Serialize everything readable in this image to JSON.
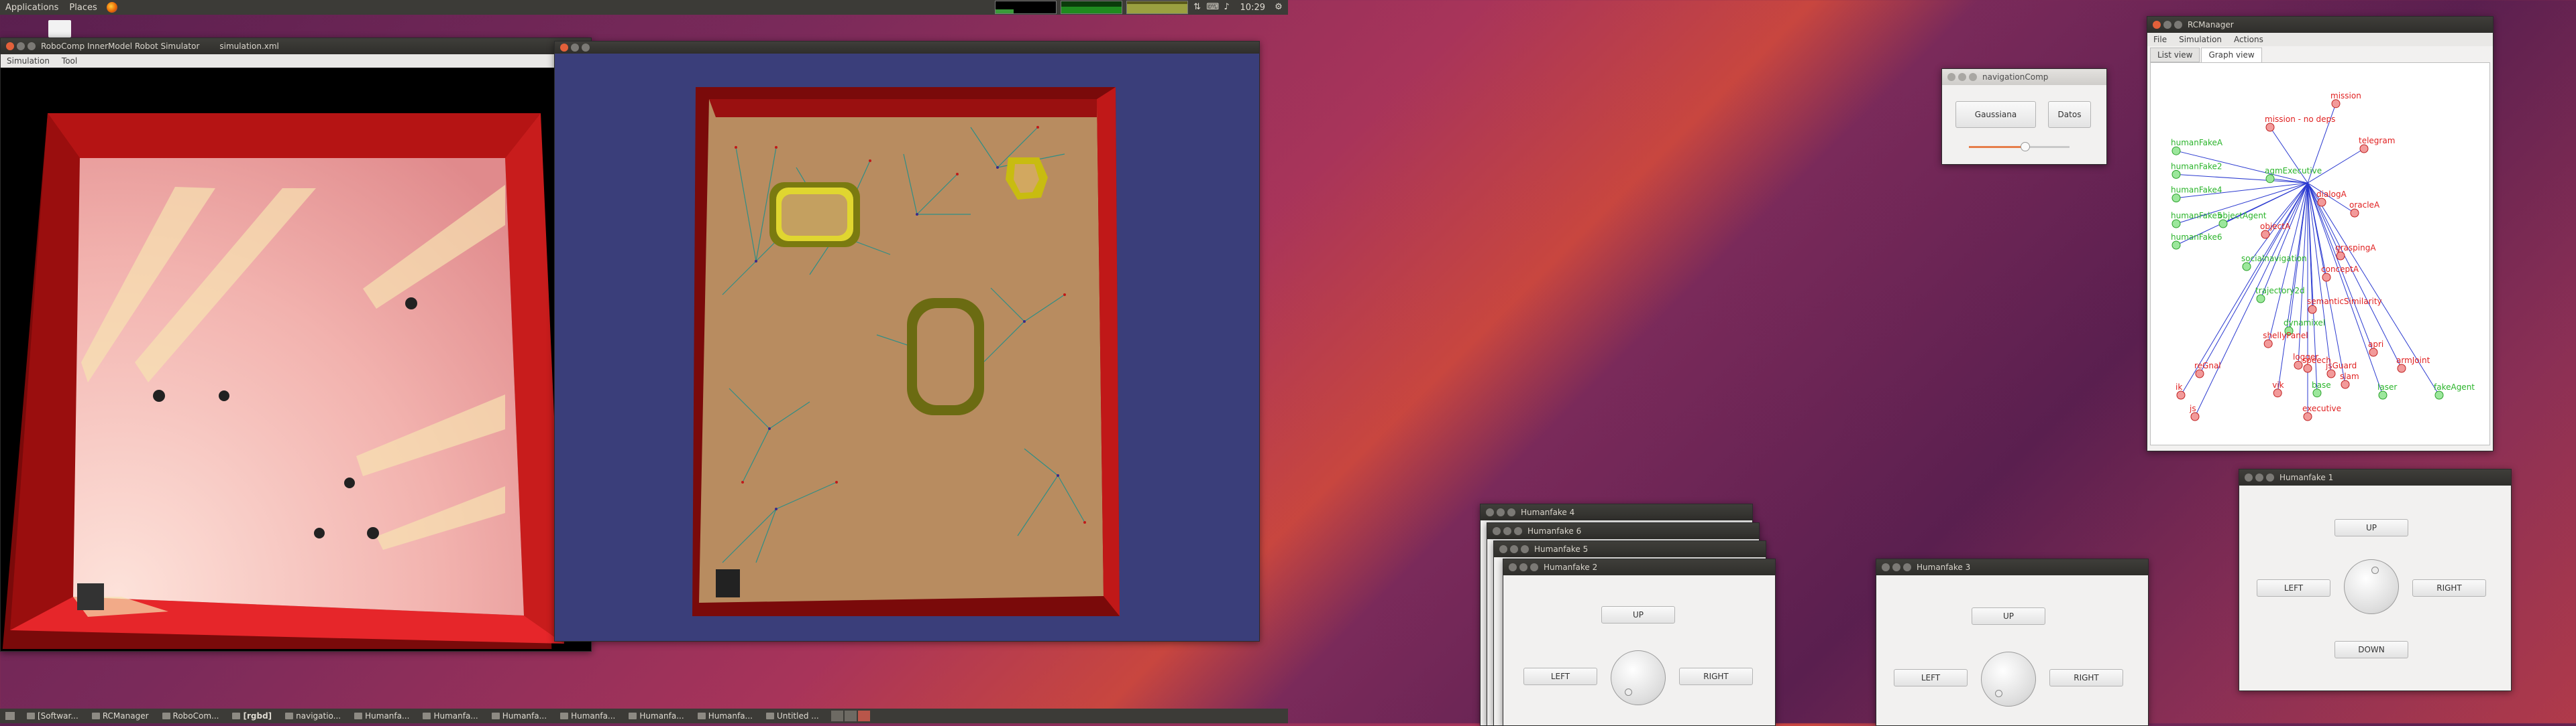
{
  "top_panel": {
    "applications": "Applications",
    "places": "Places",
    "clock": "10:29"
  },
  "simulator": {
    "title": "RoboComp InnerModel Robot Simulator",
    "file": "simulation.xml",
    "menu": [
      "Simulation",
      "Tool"
    ]
  },
  "navigation": {
    "title": "navigationComp",
    "buttons": [
      "Gaussiana",
      "Datos"
    ],
    "slider_value": 0.55
  },
  "rcmanager": {
    "title": "RCManager",
    "menu": [
      "File",
      "Simulation",
      "Actions"
    ],
    "tabs": [
      "List view",
      "Graph view"
    ],
    "active_tab": "Graph view",
    "green_nodes": [
      "humanFakeA",
      "humanFake2",
      "humanFake4",
      "humanFake5",
      "humanFake6",
      "agmExecutive",
      "objectAgent",
      "socialnavigation",
      "trajectory2d",
      "laser",
      "base",
      "fakeAgent",
      "dynamixel"
    ],
    "red_nodes": [
      "mission - no deps",
      "mission",
      "telegram",
      "dialogA",
      "oracleA",
      "graspingA",
      "semanticSimilarity",
      "shellyPanel",
      "logger",
      "vik",
      "speech",
      "jsGuard",
      "slam",
      "apri",
      "armJoint",
      "js",
      "ik",
      "executive",
      "conceptA",
      "objectA",
      "reGnal"
    ]
  },
  "humanfake_windows": [
    {
      "title": "Humanfake 4"
    },
    {
      "title": "Humanfake 6"
    },
    {
      "title": "Humanfake 5"
    },
    {
      "title": "Humanfake 2",
      "up": "UP",
      "left": "LEFT",
      "right": "RIGHT"
    },
    {
      "title": "Humanfake 3",
      "up": "UP",
      "left": "LEFT",
      "right": "RIGHT"
    },
    {
      "title": "Humanfake 1",
      "up": "UP",
      "left": "LEFT",
      "right": "RIGHT",
      "down": "DOWN"
    }
  ],
  "taskbar": {
    "items": [
      "[Softwar...",
      "RCManager",
      "RoboCom...",
      "[rgbd]",
      "navigatio...",
      "Humanfa...",
      "Humanfa...",
      "Humanfa...",
      "Humanfa...",
      "Humanfa...",
      "Humanfa...",
      "Untitled ..."
    ]
  }
}
